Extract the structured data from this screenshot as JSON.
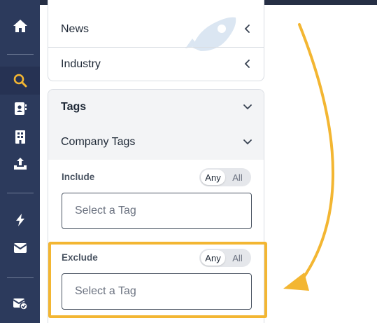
{
  "sidebar": {
    "items": [
      {
        "icon": "home-icon"
      },
      {
        "icon": "search-icon",
        "active": true
      },
      {
        "icon": "contact-card-icon"
      },
      {
        "icon": "building-icon"
      },
      {
        "icon": "upload-icon"
      },
      {
        "icon": "lightning-icon"
      },
      {
        "icon": "mail-icon"
      },
      {
        "icon": "mail-check-icon"
      }
    ],
    "active_color": "#f3b632"
  },
  "filters": {
    "news_label": "News",
    "industry_label": "Industry",
    "tags_label": "Tags",
    "company_tags_label": "Company Tags"
  },
  "include": {
    "label": "Include",
    "toggle": {
      "any": "Any",
      "all": "All",
      "selected": "Any"
    },
    "placeholder": "Select a Tag"
  },
  "exclude": {
    "label": "Exclude",
    "toggle": {
      "any": "Any",
      "all": "All",
      "selected": "Any"
    },
    "placeholder": "Select a Tag"
  },
  "annotation": {
    "highlight_color": "#f3b632"
  }
}
